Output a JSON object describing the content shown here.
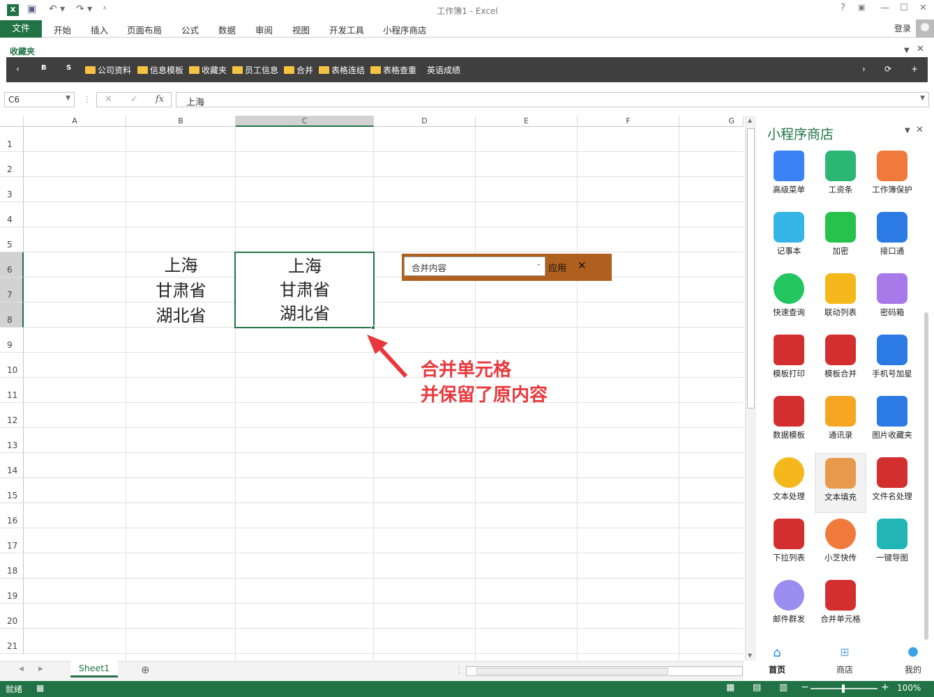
{
  "window": {
    "title": "工作簿1 - Excel",
    "help": "?"
  },
  "ribbon": {
    "file": "文件",
    "tabs": [
      "开始",
      "插入",
      "页面布局",
      "公式",
      "数据",
      "审阅",
      "视图",
      "开发工具",
      "小程序商店"
    ],
    "login": "登录"
  },
  "favorites": {
    "label": "收藏夹",
    "items": [
      "B",
      "S",
      "公司资料",
      "信息模板",
      "收藏夹",
      "员工信息",
      "合并",
      "表格连结",
      "表格查重",
      "英语成绩"
    ]
  },
  "formula_bar": {
    "cell_ref": "C6",
    "fx": "fx",
    "value": "上海"
  },
  "grid": {
    "columns": [
      "A",
      "B",
      "C",
      "D",
      "E",
      "F",
      "G"
    ],
    "rows": [
      "1",
      "2",
      "3",
      "4",
      "5",
      "6",
      "7",
      "8",
      "9",
      "10",
      "11",
      "12",
      "13",
      "14",
      "15",
      "16",
      "17",
      "18",
      "19",
      "20",
      "21"
    ],
    "b_cells": [
      "上海",
      "甘肃省",
      "湖北省"
    ],
    "c_cells": [
      "上海",
      "甘肃省",
      "湖北省"
    ]
  },
  "merge_popup": {
    "selected": "合并内容",
    "apply": "应用",
    "close": "✕"
  },
  "annotation": {
    "line1": "合并单元格",
    "line2": "并保留了原内容"
  },
  "panel": {
    "title": "小程序商店",
    "apps": [
      {
        "label": "高级菜单",
        "color": "#3b82f6"
      },
      {
        "label": "工资条",
        "color": "#2bb673"
      },
      {
        "label": "工作簿保护",
        "color": "#f07a3c"
      },
      {
        "label": "记事本",
        "color": "#33b5e5"
      },
      {
        "label": "加密",
        "color": "#26c24b"
      },
      {
        "label": "接口通",
        "color": "#2c7be5"
      },
      {
        "label": "快速查询",
        "color": "#22c55e"
      },
      {
        "label": "联动列表",
        "color": "#f5b81c"
      },
      {
        "label": "密码箱",
        "color": "#a779e9"
      },
      {
        "label": "模板打印",
        "color": "#d32f2f"
      },
      {
        "label": "模板合并",
        "color": "#d32f2f"
      },
      {
        "label": "手机号加星",
        "color": "#2c7be5"
      },
      {
        "label": "数据模板",
        "color": "#d32f2f"
      },
      {
        "label": "通讯录",
        "color": "#f5a623"
      },
      {
        "label": "图片收藏夹",
        "color": "#2c7be5"
      },
      {
        "label": "文本处理",
        "color": "#f5b81c"
      },
      {
        "label": "文本填充",
        "color": "#e89a4c"
      },
      {
        "label": "文件名处理",
        "color": "#d32f2f"
      },
      {
        "label": "下拉列表",
        "color": "#d32f2f"
      },
      {
        "label": "小芝快传",
        "color": "#f07a3c"
      },
      {
        "label": "一键导图",
        "color": "#22b5b5"
      },
      {
        "label": "邮件群发",
        "color": "#9b8cf0"
      },
      {
        "label": "合并单元格",
        "color": "#d32f2f"
      }
    ],
    "nav": [
      "首页",
      "商店",
      "我的"
    ]
  },
  "sheet": {
    "tab": "Sheet1"
  },
  "status": {
    "ready": "就绪",
    "zoom": "100%"
  }
}
